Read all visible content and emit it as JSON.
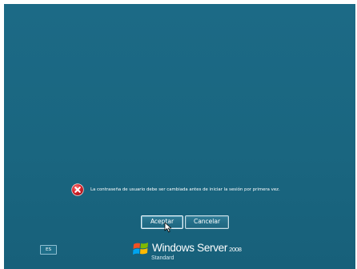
{
  "message": {
    "icon": "error-icon",
    "text": "La contraseña de usuario debe ser cambiada antes de iniciar la sesión por primera vez."
  },
  "buttons": {
    "ok_label": "Aceptar",
    "cancel_label": "Cancelar"
  },
  "language": {
    "code": "ES"
  },
  "brand": {
    "name": "Windows Server",
    "year": "2008",
    "edition": "Standard"
  },
  "colors": {
    "background": "#1a6680",
    "error": "#d9242b"
  }
}
